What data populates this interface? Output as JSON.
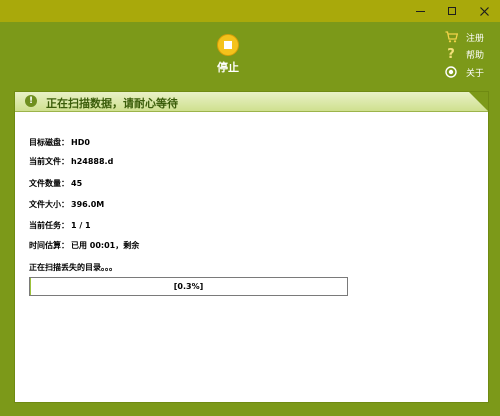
{
  "toolbar": {
    "stop_label": "停止",
    "menu": {
      "register": "注册",
      "help": "帮助",
      "about": "关于"
    }
  },
  "banner": {
    "text": "正在扫描数据，请耐心等待"
  },
  "info": {
    "target_disk_label": "目标磁盘：",
    "target_disk_value": "HD0",
    "current_file_label": "当前文件：",
    "current_file_value": "h24888.d",
    "file_count_label": "文件数量：",
    "file_count_value": "45",
    "file_size_label": "文件大小：",
    "file_size_value": "396.0M",
    "current_task_label": "当前任务：",
    "current_task_value": "1 / 1",
    "time_estimate_label": "时间估算：",
    "time_estimate_value": "已用 00:01，剩余",
    "scanning_text": "正在扫描丢失的目录。。。"
  },
  "progress": {
    "text": "[0.3%]",
    "percent": 0.3
  },
  "colors": {
    "window_bg": "#7c9919",
    "titlebar": "#a9a90b",
    "stop_button": "#f4c21b",
    "banner_text": "#3b5d0a"
  }
}
